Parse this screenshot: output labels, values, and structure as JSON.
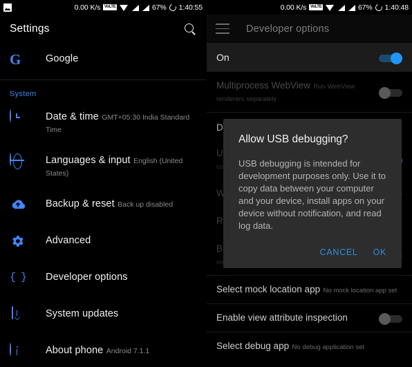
{
  "status_bar_left": {
    "notification_icon": "screenshot-icon",
    "net_speed": "0.00 K/s",
    "volte": "VoLTE",
    "wifi_icon": "wifi-icon",
    "signal_icon_1": "signal-bars-icon",
    "signal_icon_2": "signal-bars-icon",
    "battery_percent": "67%",
    "battery_icon": "battery-circle-icon",
    "time": "1:40:55"
  },
  "status_bar_right": {
    "net_speed": "0.00 K/s",
    "volte": "VoLTE",
    "wifi_icon": "wifi-icon",
    "signal_icon_1": "signal-bars-icon",
    "signal_icon_2": "signal-bars-icon",
    "battery_percent": "67%",
    "battery_icon": "battery-circle-icon",
    "time": "1:40:48"
  },
  "left_panel": {
    "app_bar": {
      "title": "Settings",
      "search_icon": "search-icon"
    },
    "account_row": {
      "icon": "google-g-icon",
      "title": "Google"
    },
    "section_label": "System",
    "items": [
      {
        "icon": "clock-icon",
        "title": "Date & time",
        "sub": "GMT+05:30 India Standard Time"
      },
      {
        "icon": "globe-icon",
        "title": "Languages & input",
        "sub": "English (United States)"
      },
      {
        "icon": "cloud-upload-icon",
        "title": "Backup & reset",
        "sub": "Back up disabled"
      },
      {
        "icon": "gear-icon",
        "title": "Advanced",
        "sub": ""
      },
      {
        "icon": "braces-icon",
        "title": "Developer options",
        "sub": ""
      },
      {
        "icon": "system-update-icon",
        "title": "System updates",
        "sub": ""
      },
      {
        "icon": "info-icon",
        "title": "About phone",
        "sub": "Android 7.1.1"
      }
    ]
  },
  "right_panel": {
    "app_bar": {
      "menu_icon": "hamburger-menu-icon",
      "title": "Developer options"
    },
    "master_toggle": {
      "label": "On",
      "state": "on"
    },
    "items_above": [
      {
        "title": "Multiprocess WebView",
        "sub": "Run WebView renderers separately",
        "toggle": "off"
      }
    ],
    "section_header": "Demo mode",
    "items_behind_dialog": [
      {
        "title": "USB debugging",
        "sub": "Debug mode when USB is connected",
        "toggle": "on"
      },
      {
        "title": "Wireless display certification",
        "sub": "",
        "toggle": "off"
      },
      {
        "title": "Revoke USB debugging authorizations",
        "sub": "",
        "toggle": ""
      },
      {
        "title": "Bug report shortcut",
        "sub": "Show a button in the power menu for taking a bug report",
        "toggle": "off"
      }
    ],
    "items_below": [
      {
        "title": "Select mock location app",
        "sub": "No mock location app set",
        "toggle": ""
      },
      {
        "title": "Enable view attribute inspection",
        "sub": "",
        "toggle": "off"
      },
      {
        "title": "Select debug app",
        "sub": "No debug application set",
        "toggle": ""
      }
    ]
  },
  "dialog": {
    "title": "Allow USB debugging?",
    "body": "USB debugging is intended for development purposes only. Use it to copy data between your computer and your device, install apps on your device without notification, and read log data.",
    "cancel": "CANCEL",
    "ok": "OK"
  },
  "colors": {
    "accent": "#4285f4",
    "toggle_on": "#2196f3",
    "dialog_bg": "#2d2d2d",
    "dialog_action": "#2e8fe0"
  }
}
